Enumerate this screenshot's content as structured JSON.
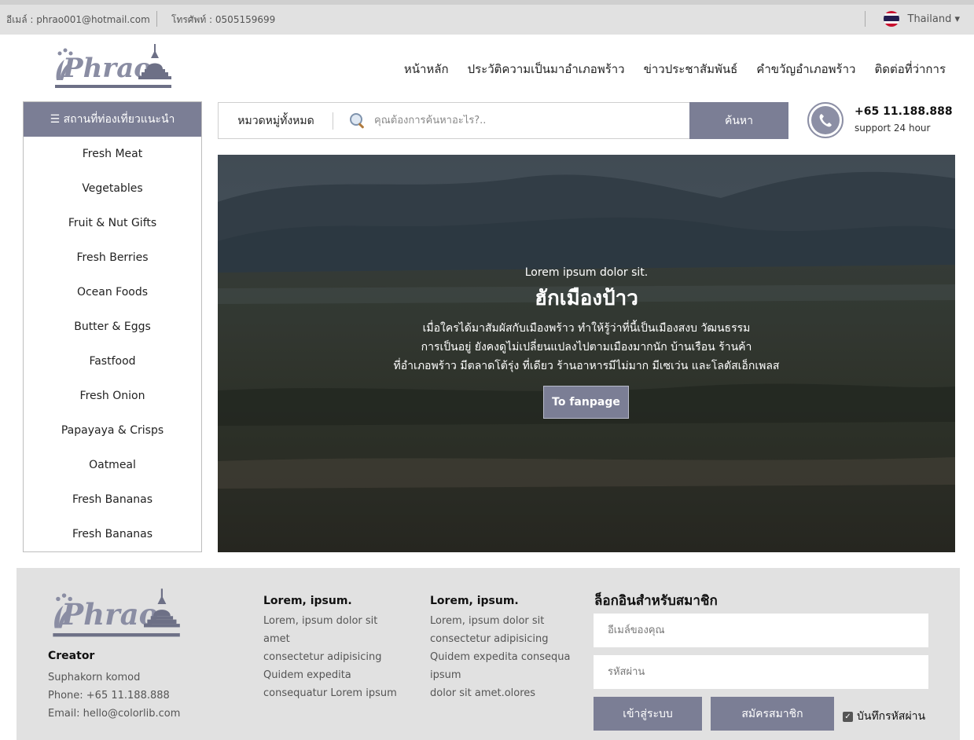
{
  "topbar": {
    "email": "อีเมล์ : phrao001@hotmail.com",
    "phone": "โทรศัพท์ : 0505159699",
    "language": "Thailand ▾"
  },
  "brand": {
    "logo_text": "Phrao"
  },
  "nav": {
    "items": [
      "หน้าหลัก",
      "ประวัติความเป็นมาอำเภอพร้าว",
      "ข่าวประชาสัมพันธ์",
      "คำขวัญอำเภอพร้าว",
      "ติดต่อที่ว่าการ"
    ]
  },
  "sidebar": {
    "title": "☰ สถานที่ท่องเที่ยวแนะนำ",
    "items": [
      "Fresh Meat",
      "Vegetables",
      "Fruit & Nut Gifts",
      "Fresh Berries",
      "Ocean Foods",
      "Butter & Eggs",
      "Fastfood",
      "Fresh Onion",
      "Papayaya & Crisps",
      "Oatmeal",
      "Fresh Bananas",
      "Fresh Bananas"
    ]
  },
  "search": {
    "category": "หมวดหมู่ทั้งหมด",
    "placeholder": "คุณต้องการค้นหาอะไร?..",
    "button": "ค้นหา"
  },
  "support": {
    "phone": "+65 11.188.888",
    "hours": "support 24 hour"
  },
  "hero": {
    "kicker": "Lorem ipsum dolor sit.",
    "title": "ฮักเมืองป้าว",
    "lines": [
      "เมื่อใครได้มาสัมผัสกับเมืองพร้าว ทำให้รู้ว่าที่นี้เป็นเมืองสงบ วัฒนธรรม",
      "การเป็นอยู่ ยังคงดูไม่เปลี่ยนแปลงไปตามเมืองมากนัก บ้านเรือน ร้านค้า",
      "ที่อำเภอพร้าว มีตลาดโต้รุ่ง ที่เดียว ร้านอาหารมีไม่มาก มีเซเว่น และโลตัสเอ็กเพลส"
    ],
    "button": "To fanpage"
  },
  "footer": {
    "creator_title": "Creator",
    "creator_name": "Suphakorn komod",
    "creator_phone": "Phone: +65 11.188.888",
    "creator_email": "Email: hello@colorlib.com",
    "col1": {
      "title": "Lorem, ipsum.",
      "lines": [
        "Lorem, ipsum dolor sit",
        "amet",
        "consectetur adipisicing",
        "Quidem expedita",
        "consequatur Lorem ipsum"
      ]
    },
    "col2": {
      "title": "Lorem, ipsum.",
      "lines": [
        "Lorem, ipsum dolor sit",
        "consectetur adipisicing",
        "Quidem expedita consequa",
        "ipsum",
        "dolor sit amet.olores"
      ]
    },
    "login": {
      "title": "ล็อกอินสำหรับสมาชิก",
      "email_placeholder": "อีเมล์ของคุณ",
      "password_placeholder": "รหัสผ่าน",
      "login_button": "เข้าสู่ระบบ",
      "register_button": "สมัครสมาชิก",
      "remember": "บันทึกรหัสผ่าน"
    }
  },
  "colors": {
    "accent": "#7b7e95",
    "topbar": "#e1e1e1",
    "footer": "#e1e1e1"
  }
}
